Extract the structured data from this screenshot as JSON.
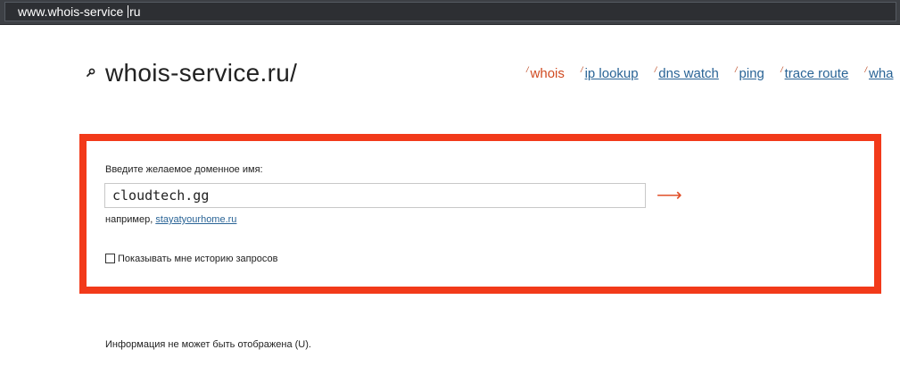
{
  "browser": {
    "url_before_caret": "www.whois-service ",
    "url_after_caret": "ru"
  },
  "header": {
    "logo_icon": "search-icon",
    "logo_text": "whois-service.ru/",
    "nav": [
      {
        "slash": "/",
        "label": "whois",
        "current": true
      },
      {
        "slash": "/",
        "label": "ip lookup",
        "current": false
      },
      {
        "slash": "/",
        "label": "dns watch",
        "current": false
      },
      {
        "slash": "/",
        "label": "ping",
        "current": false
      },
      {
        "slash": "/",
        "label": "trace route",
        "current": false
      },
      {
        "slash": "/",
        "label": "wha",
        "current": false
      }
    ]
  },
  "form": {
    "label": "Введите желаемое доменное имя:",
    "domain_value": "cloudtech.gg",
    "submit_icon": "arrow-right-icon",
    "submit_glyph": "⟶",
    "example_prefix": "например, ",
    "example_link": "stayatyourhome.ru",
    "history_checked": false,
    "history_label": "Показывать мне историю запросов"
  },
  "info": {
    "message": "Информация не может быть отображена (U)."
  },
  "colors": {
    "highlight_frame": "#f23a1a",
    "nav_current": "#d04a20",
    "link": "#2a6496",
    "arrow": "#e0502a"
  }
}
